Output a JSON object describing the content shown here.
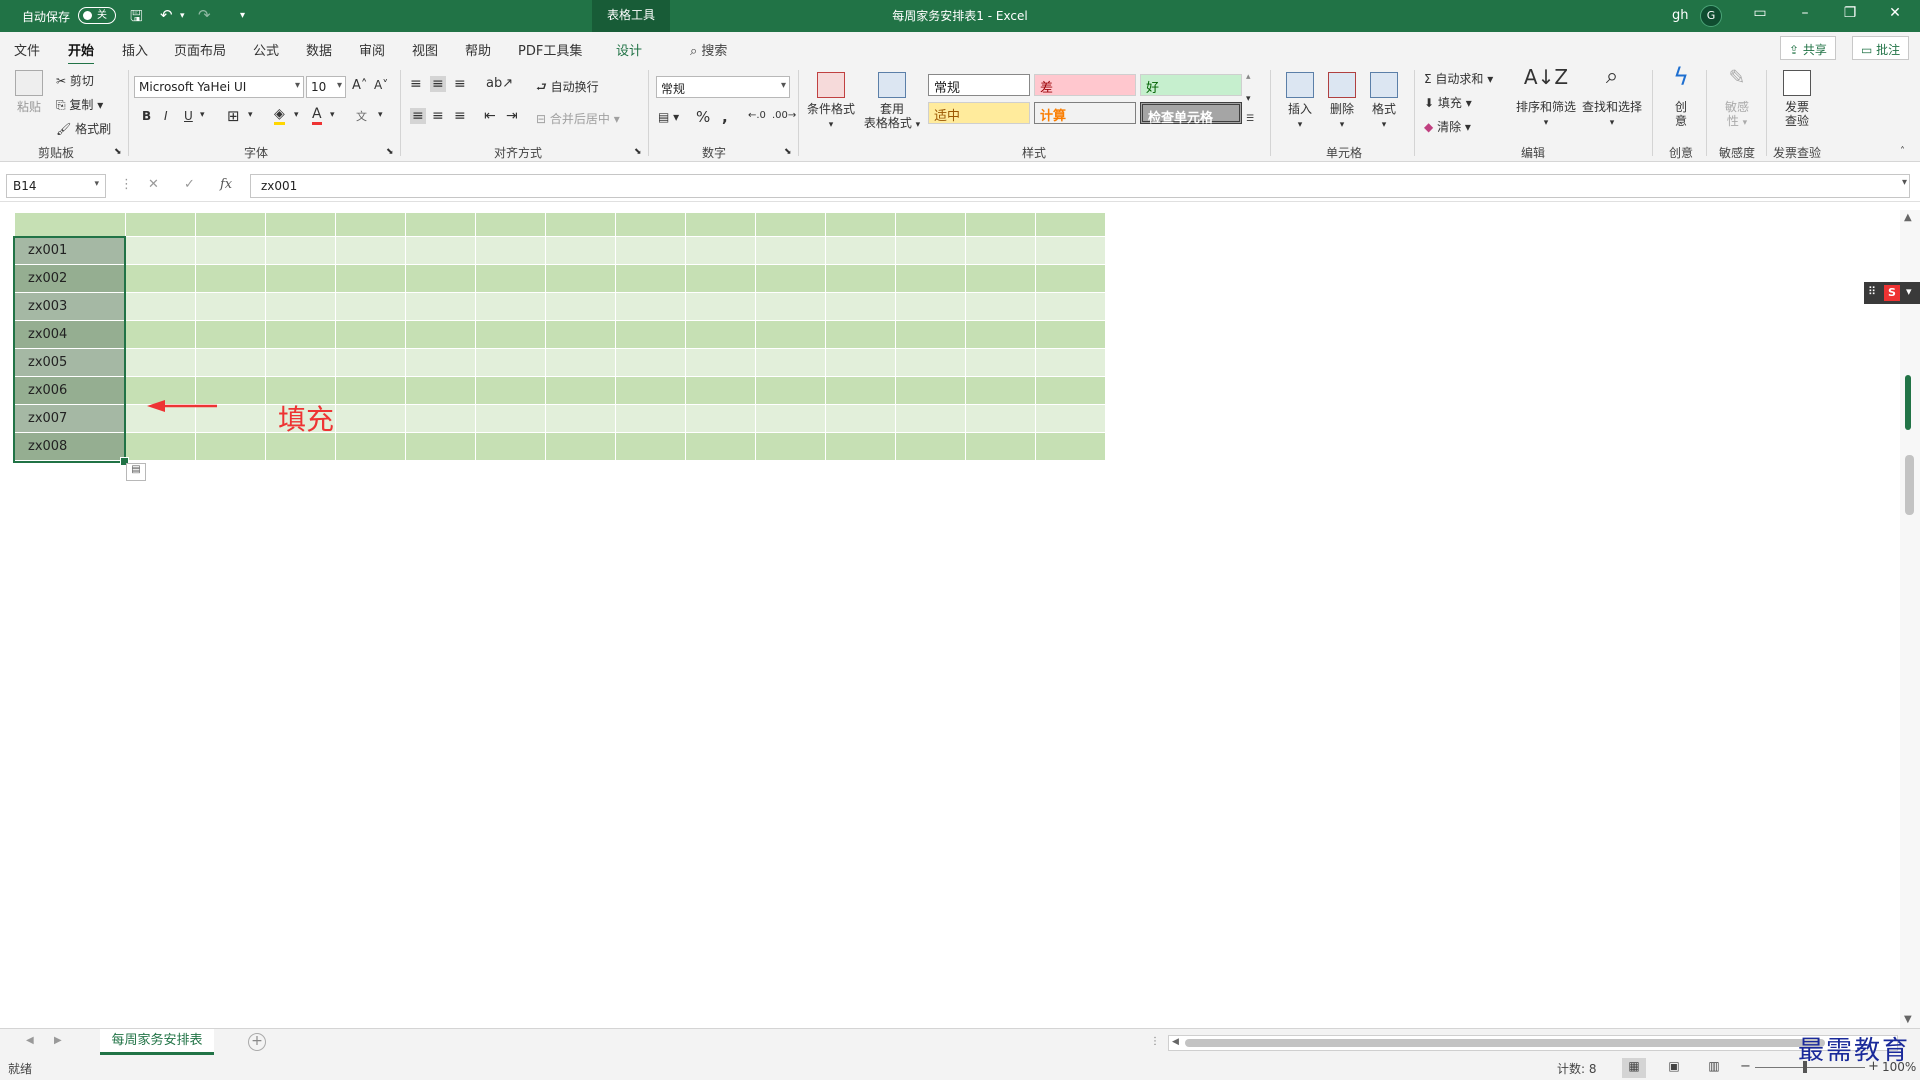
{
  "titlebar": {
    "autosave_label": "自动保存",
    "autosave_state": "关",
    "table_tools": "表格工具",
    "title": "每周家务安排表1  -  Excel",
    "user": "gh",
    "avatar_letter": "G"
  },
  "tabs": {
    "items": [
      "文件",
      "开始",
      "插入",
      "页面布局",
      "公式",
      "数据",
      "审阅",
      "视图",
      "帮助",
      "PDF工具集",
      "设计"
    ],
    "active": "开始",
    "search": "搜索",
    "share": "共享",
    "comment": "批注"
  },
  "ribbon": {
    "clipboard": {
      "paste": "粘贴",
      "cut": "剪切",
      "copy": "复制",
      "format_painter": "格式刷",
      "label": "剪贴板"
    },
    "font": {
      "name": "Microsoft YaHei UI",
      "size": "10",
      "bold": "B",
      "italic": "I",
      "underline": "U",
      "label": "字体"
    },
    "alignment": {
      "wrap": "自动换行",
      "merge": "合并后居中",
      "label": "对齐方式"
    },
    "number": {
      "format": "常规",
      "label": "数字"
    },
    "styles": {
      "conditional": "条件格式",
      "table_format_1": "套用",
      "table_format_2": "表格格式",
      "normal": "常规",
      "bad": "差",
      "good": "好",
      "neutral": "适中",
      "calculation": "计算",
      "check_cell": "检查单元格",
      "label": "样式"
    },
    "cells": {
      "insert": "插入",
      "delete": "删除",
      "format": "格式",
      "label": "单元格"
    },
    "editing": {
      "autosum": "自动求和",
      "fill": "填充",
      "clear": "清除",
      "sort": "排序和筛选",
      "find": "查找和选择",
      "label": "编辑"
    },
    "creativity": {
      "btn_1": "创",
      "btn_2": "意",
      "label": "创意"
    },
    "sensitivity": {
      "btn_1": "敏感",
      "btn_2": "性",
      "label": "敏感度"
    },
    "invoice": {
      "btn_1": "发票",
      "btn_2": "查验",
      "label": "发票查验"
    }
  },
  "formula_bar": {
    "cell_ref": "B14",
    "cancel": "✕",
    "enter": "✓",
    "fx": "fx",
    "content": "zx001"
  },
  "grid": {
    "values": [
      "zx001",
      "zx002",
      "zx003",
      "zx004",
      "zx005",
      "zx006",
      "zx007",
      "zx008"
    ]
  },
  "annotation": "填充",
  "sheet_tab": "每周家务安排表",
  "status": {
    "ready": "就绪",
    "count": "计数: 8",
    "zoom": "100%"
  },
  "watermark": "最需教育",
  "colors": {
    "brand": "#217346",
    "annotation": "#ee3333"
  }
}
